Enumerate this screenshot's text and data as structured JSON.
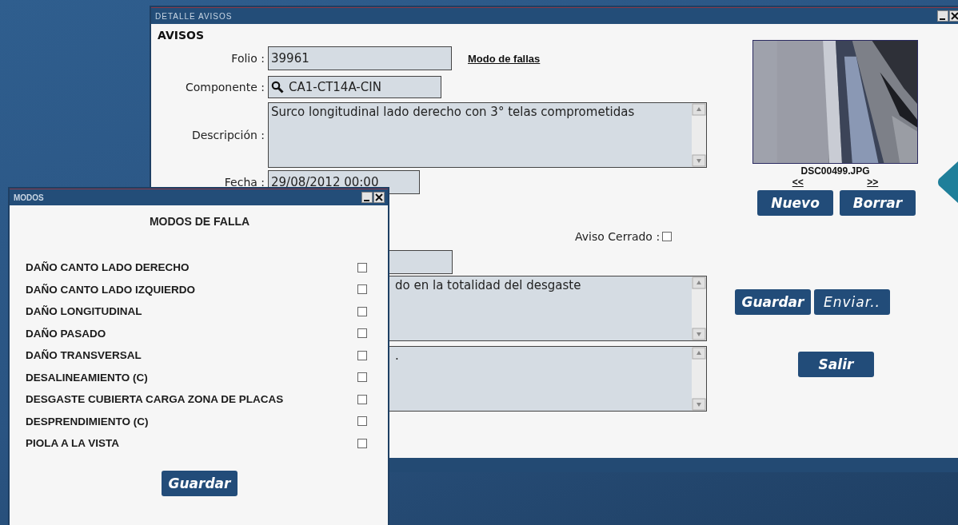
{
  "main_window": {
    "title": "DETALLE AVISOS",
    "heading": "AVISOS",
    "folio": {
      "label": "Folio :",
      "value": "39961"
    },
    "modes_link": "Modo de fallas",
    "componente": {
      "label": "Componente :",
      "value": "CA1-CT14A-CIN"
    },
    "descripcion": {
      "label": "Descripción :",
      "value": "Surco longitudinal lado derecho con 3° telas comprometidas"
    },
    "fecha": {
      "label": "Fecha :",
      "value": "29/08/2012 00:00"
    },
    "aviso_cerrado": {
      "label": "Aviso Cerrado :",
      "checked": false
    },
    "notes": [
      {
        "value": "do en la totalidad del desgaste"
      },
      {
        "value": "."
      }
    ],
    "photo": {
      "filename": "DSC00499.JPG",
      "prev": "<<",
      "next": ">>"
    },
    "photo_buttons": [
      "Nuevo",
      "Borrar"
    ],
    "actions": [
      "Guardar",
      "Enviar.."
    ],
    "exit": "Salir"
  },
  "modes_window": {
    "title": "MODOS",
    "heading": "MODOS DE FALLA",
    "modes": [
      {
        "label": "DAÑO CANTO LADO DERECHO",
        "checked": false
      },
      {
        "label": "DAÑO CANTO LADO IZQUIERDO",
        "checked": false
      },
      {
        "label": "DAÑO LONGITUDINAL",
        "checked": false
      },
      {
        "label": "DAÑO PASADO",
        "checked": false
      },
      {
        "label": "DAÑO TRANSVERSAL",
        "checked": false
      },
      {
        "label": "DESALINEAMIENTO (C)",
        "checked": false
      },
      {
        "label": "DESGASTE CUBIERTA CARGA ZONA DE PLACAS",
        "checked": false
      },
      {
        "label": "DESPRENDIMIENTO (C)",
        "checked": false
      },
      {
        "label": "PIOLA A LA VISTA",
        "checked": false
      }
    ],
    "save": "Guardar"
  }
}
